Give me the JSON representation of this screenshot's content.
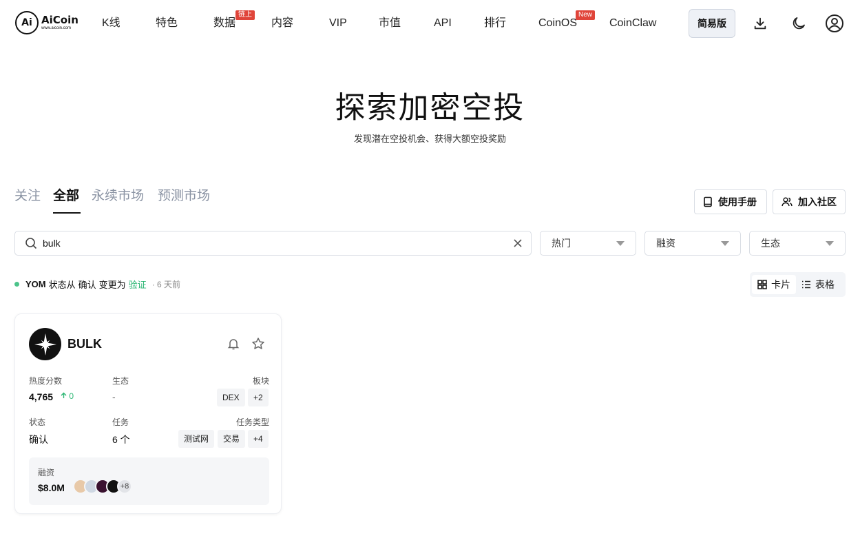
{
  "header": {
    "logo": {
      "mark": "Ai",
      "name": "AiCoin",
      "sub": "www.aicoin.com"
    },
    "nav": [
      {
        "label": "K线"
      },
      {
        "label": "特色"
      },
      {
        "label": "数据",
        "badge": "链上"
      },
      {
        "label": "内容"
      },
      {
        "label": "VIP"
      },
      {
        "label": "市值"
      },
      {
        "label": "API"
      },
      {
        "label": "排行"
      },
      {
        "label": "CoinOS",
        "badge": "New"
      },
      {
        "label": "CoinClaw"
      }
    ],
    "simple_mode": "简易版",
    "icons": [
      "download-icon",
      "moon-icon",
      "user-icon"
    ]
  },
  "hero": {
    "title": "探索加密空投",
    "subtitle": "发现潜在空投机会、获得大额空投奖励"
  },
  "tabs": [
    {
      "label": "关注",
      "active": false
    },
    {
      "label": "全部",
      "active": true
    },
    {
      "label": "永续市场",
      "active": false
    },
    {
      "label": "预测市场",
      "active": false
    }
  ],
  "actions": {
    "manual": "使用手册",
    "community": "加入社区"
  },
  "filters": {
    "search_value": "bulk",
    "hot": "热门",
    "funding": "融资",
    "ecosystem": "生态"
  },
  "status": {
    "project": "YOM",
    "from_text": "状态从",
    "from": "确认",
    "to_text": "变更为",
    "to": "验证",
    "time": "· 6 天前"
  },
  "view": {
    "card": "卡片",
    "table": "表格"
  },
  "card": {
    "name": "BULK",
    "heat_label": "热度分数",
    "heat_value": "4,765",
    "heat_change": "0",
    "eco_label": "生态",
    "eco_value": "-",
    "sector_label": "板块",
    "sector_tags": [
      "DEX",
      "+2"
    ],
    "status_label": "状态",
    "status_value": "确认",
    "tasks_label": "任务",
    "tasks_value": "6 个",
    "task_type_label": "任务类型",
    "task_tags": [
      "测试网",
      "交易",
      "+4"
    ],
    "funding_label": "融资",
    "funding_value": "$8.0M",
    "investors_more": "+8"
  },
  "colors": {
    "accent_green": "#2bb673",
    "badge_red": "#e0453a"
  }
}
